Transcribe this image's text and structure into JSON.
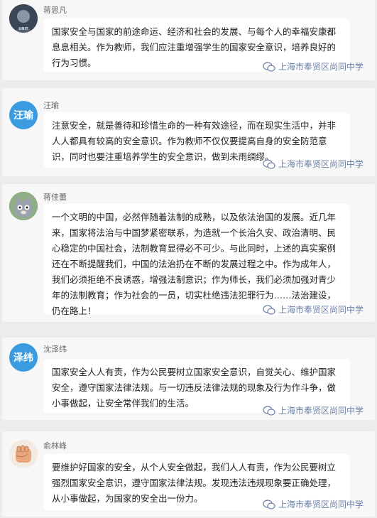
{
  "watermark": "上海市奉贤区尚同中学",
  "avatar_logo_text": "UNIT",
  "comments": [
    {
      "name": "蒋思凡",
      "avatar_type": "photo-dark",
      "text": "国家安全与国家的前途命运、经济和社会的发展、与每个人的幸福安康都息息相关。作为教师，我们应注重增强学生的国家安全意识，培养良好的行为习惯。"
    },
    {
      "name": "汪瑜",
      "avatar_type": "text",
      "avatar_text": "汪瑜",
      "avatar_color": "#3a9be0",
      "text": "注意安全，就是善待和珍惜生命的一种有效途径，而在现实生活中，并非人人都具有较高的安全意识。作为教师不仅仅要提高自身的安全防范意识，同时也要注重培养学生的安全意识，做到未雨绸缪。"
    },
    {
      "name": "蒋佳蕾",
      "avatar_type": "cartoon-cat",
      "text": "一个文明的中国，必然伴随着法制的成熟，以及依法治国的发展。近几年来，国家将法治与中国梦紧密联系，为造就一个长治久安、政治清明、民心稳定的中国社会，法制教育显得必不可少。与此同时，上述的真实案例还在不断提醒我们，中国的法治扔在不断的发展过程之中。作为成年人，我们必须拒绝不良诱惑，增强法制意识；作为师长，我们必须加强对青少年的法制教育；作为社会的一员，切实杜绝违法犯罪行为……法治建设，仍在路上！"
    },
    {
      "name": "沈泽纬",
      "avatar_type": "text",
      "avatar_text": "泽纬",
      "avatar_color": "#3a9be0",
      "text": "国家安全人人有责，作为公民要树立国家安全意识，自觉关心、维护国家安全，遵守国家法律法规。与一切违反法律法规的现象及行为作斗争，做小事做起，让安全常伴我们的生活。"
    },
    {
      "name": "俞林峰",
      "avatar_type": "fist",
      "text": "要维护好国家的安全，从个人安全做起，我们人人有责，作为公民要树立强烈国家安全意识，遵守国家法律法规。发现违法违规现象要正确处理，从小事做起，为国家的安全出一份力。"
    }
  ]
}
